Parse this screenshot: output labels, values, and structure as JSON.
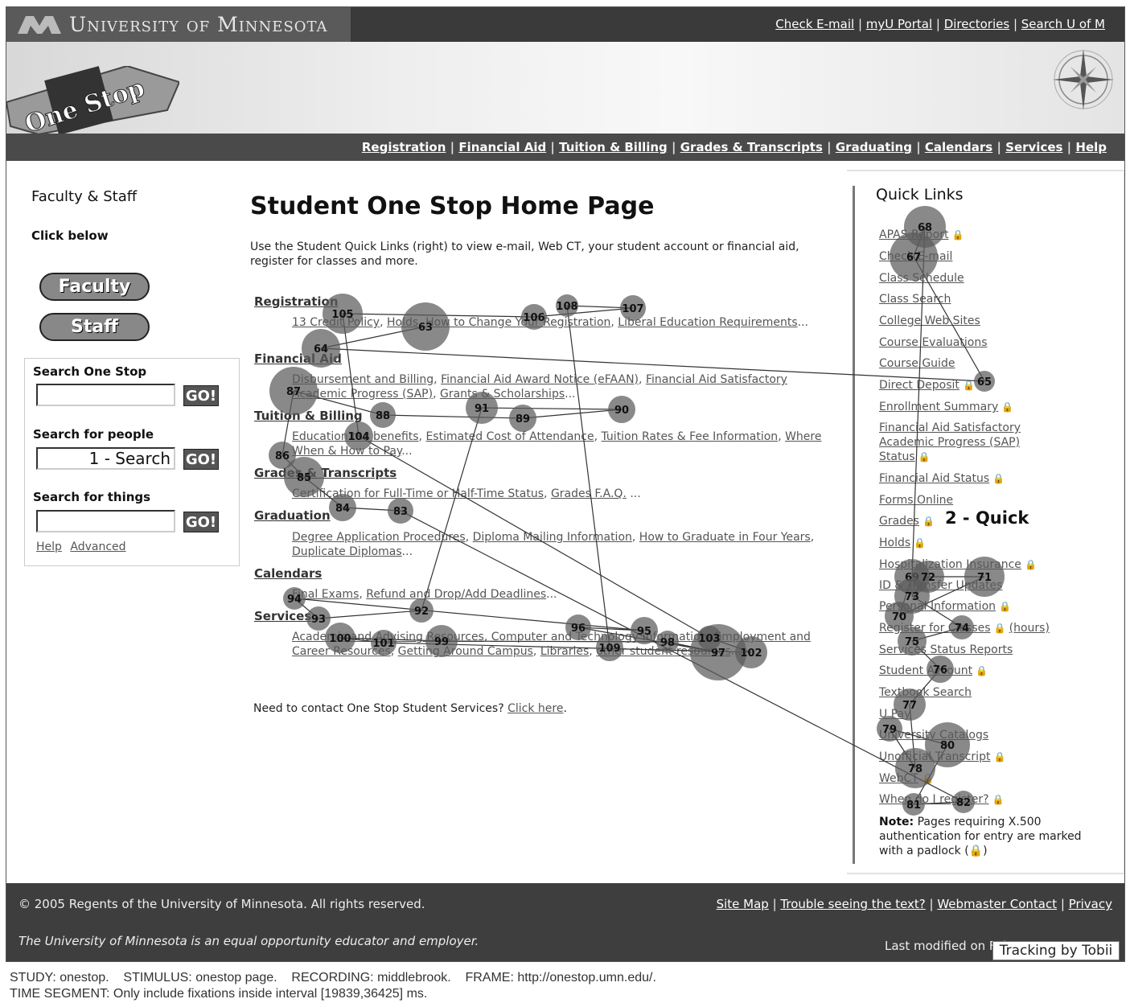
{
  "header": {
    "university": "University of Minnesota",
    "util_links": [
      "Check E-mail",
      "myU Portal",
      "Directories",
      "Search U of M"
    ],
    "site_logo_text": "One Stop"
  },
  "nav": [
    "Registration",
    "Financial Aid",
    "Tuition & Billing",
    "Grades & Transcripts",
    "Graduating",
    "Calendars",
    "Services",
    "Help"
  ],
  "left": {
    "title": "Faculty & Staff",
    "subtitle": "Click below",
    "faculty_button": "Faculty",
    "staff_button": "Staff",
    "search_one_stop_label": "Search One Stop",
    "search_one_stop_value": "",
    "search_people_label": "Search for people",
    "search_people_value": "1 - Search",
    "search_things_label": "Search for things",
    "search_things_value": "",
    "go_label": "GO!",
    "help_link": "Help",
    "advanced_link": "Advanced"
  },
  "main": {
    "title": "Student One Stop Home Page",
    "intro": "Use the Student Quick Links (right) to view e-mail, Web CT, your student account or financial aid, register for classes and more.",
    "sections": [
      {
        "title": "Registration",
        "links": [
          "13 Credit Policy",
          "Holds",
          "How to Change Your Registration",
          "Liberal Education Requirements"
        ]
      },
      {
        "title": "Financial Aid",
        "links": [
          "Disbursement and Billing",
          "Financial Aid Award Notice (eFAAN)",
          "Financial Aid Satisfactory Academic Progress (SAP)",
          "Grants & Scholarships"
        ]
      },
      {
        "title": "Tuition & Billing",
        "links": [
          "Education tax benefits",
          "Estimated Cost of Attendance",
          "Tuition Rates & Fee Information",
          "Where When & How to Pay"
        ]
      },
      {
        "title": "Grades & Transcripts",
        "links": [
          "Certification for Full-Time or Half-Time Status",
          "Grades F.A.Q."
        ]
      },
      {
        "title": "Graduation",
        "links": [
          "Degree Application Procedures",
          "Diploma Mailing Information",
          "How to Graduate in Four Years",
          "Duplicate Diplomas"
        ]
      },
      {
        "title": "Calendars",
        "links": [
          "Final Exams",
          "Refund and Drop/Add Deadlines"
        ]
      },
      {
        "title": "Services",
        "links": [
          "Academic and Advising Resources",
          "Computer and Technology Information",
          "Employment and Career Resources",
          "Getting Around Campus",
          "Libraries",
          "other student resources"
        ]
      }
    ],
    "contact_text": "Need to contact One Stop Student Services?",
    "contact_link": "Click here"
  },
  "quick_links": {
    "title": "Quick Links",
    "items": [
      {
        "label": "APAS Report",
        "lock": true
      },
      {
        "label": "Check E-mail",
        "lock": false
      },
      {
        "label": "Class Schedule",
        "lock": false
      },
      {
        "label": "Class Search",
        "lock": false
      },
      {
        "label": "College Web Sites",
        "lock": false
      },
      {
        "label": "Course Evaluations",
        "lock": false
      },
      {
        "label": "Course Guide",
        "lock": false
      },
      {
        "label": "Direct Deposit",
        "lock": true
      },
      {
        "label": "Enrollment Summary",
        "lock": true
      },
      {
        "label": "Financial Aid Satisfactory Academic Progress (SAP) Status",
        "lock": true
      },
      {
        "label": "Financial Aid Status",
        "lock": true
      },
      {
        "label": "Forms Online",
        "lock": false
      },
      {
        "label": "Grades",
        "lock": true
      },
      {
        "label": "Holds",
        "lock": true
      },
      {
        "label": "Hospitalization Insurance",
        "lock": true
      },
      {
        "label": "ID & Transfer Updates",
        "lock": false
      },
      {
        "label": "Personal Information",
        "lock": true
      },
      {
        "label": "Register for Classes",
        "lock": true,
        "suffix": "(hours)"
      },
      {
        "label": "Services Status Reports",
        "lock": false
      },
      {
        "label": "Student Account",
        "lock": true
      },
      {
        "label": "Textbook Search",
        "lock": false
      },
      {
        "label": "U Pay",
        "lock": false
      },
      {
        "label": "University Catalogs",
        "lock": false
      },
      {
        "label": "Unofficial Transcript",
        "lock": true
      },
      {
        "label": "WebCT",
        "lock": true
      },
      {
        "label": "When do I register?",
        "lock": true
      }
    ],
    "note_bold": "Note:",
    "note": "Pages requiring X.500 authentication for entry are marked with a padlock (🔒)",
    "overlay_annotation": "2 - Quick"
  },
  "footer": {
    "copyright": "© 2005 Regents of the University of Minnesota. All rights reserved.",
    "links": [
      "Site Map",
      "Trouble seeing the text?",
      "Webmaster Contact",
      "Privacy"
    ],
    "eoe": "The University of Minnesota is an equal opportunity educator and employer.",
    "last_modified": "Last modified on February 16, 2005"
  },
  "tracking": {
    "badge": "Tracking by Tobii",
    "meta_line1": "STUDY: onestop.    STIMULUS: onestop page.    RECORDING: middlebrook.    FRAME: http://onestop.umn.edu/.",
    "meta_line2": "TIME SEGMENT: Only include fixations inside interval [19839,36425] ms."
  },
  "colors": {
    "fixation_fill": "#5c5c5c",
    "scanpath_stroke": "#333333"
  },
  "fixations": [
    {
      "n": 63
    },
    {
      "n": 64
    },
    {
      "n": 65
    },
    {
      "n": 67
    },
    {
      "n": 68
    },
    {
      "n": 69
    },
    {
      "n": 70
    },
    {
      "n": 71
    },
    {
      "n": 72
    },
    {
      "n": 73
    },
    {
      "n": 74
    },
    {
      "n": 75
    },
    {
      "n": 76
    },
    {
      "n": 77
    },
    {
      "n": 78
    },
    {
      "n": 79
    },
    {
      "n": 80
    },
    {
      "n": 81
    },
    {
      "n": 82
    },
    {
      "n": 83
    },
    {
      "n": 84
    },
    {
      "n": 85
    },
    {
      "n": 86
    },
    {
      "n": 87
    },
    {
      "n": 88
    },
    {
      "n": 89
    },
    {
      "n": 90
    },
    {
      "n": 91
    },
    {
      "n": 92
    },
    {
      "n": 93
    },
    {
      "n": 94
    },
    {
      "n": 95
    },
    {
      "n": 96
    },
    {
      "n": 97
    },
    {
      "n": 98
    },
    {
      "n": 99
    },
    {
      "n": 100
    },
    {
      "n": 101
    },
    {
      "n": 102
    },
    {
      "n": 103
    },
    {
      "n": 104
    },
    {
      "n": 105
    },
    {
      "n": 106
    },
    {
      "n": 107
    },
    {
      "n": 108
    },
    {
      "n": 109
    }
  ]
}
